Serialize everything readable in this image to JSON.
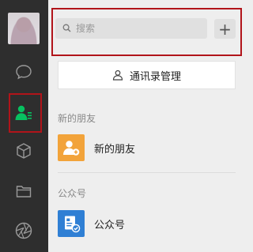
{
  "search": {
    "placeholder": "搜索",
    "add_label": "+"
  },
  "contacts_management": {
    "label": "通讯录管理"
  },
  "sections": {
    "new_friends": {
      "header": "新的朋友",
      "item_label": "新的朋友"
    },
    "official_accounts": {
      "header": "公众号",
      "item_label": "公众号"
    }
  },
  "colors": {
    "sidebar_bg": "#2e2e2e",
    "accent_green": "#07c160",
    "highlight_red": "#b1141a",
    "new_friends_icon_bg": "#f2a33a",
    "official_accounts_icon_bg": "#2f7fd4"
  },
  "sidebar": {
    "items": [
      {
        "icon": "avatar"
      },
      {
        "icon": "chat-icon"
      },
      {
        "icon": "contacts-icon",
        "active": true
      },
      {
        "icon": "favorites-box-icon"
      },
      {
        "icon": "folder-icon"
      },
      {
        "icon": "moments-aperture-icon"
      }
    ]
  }
}
